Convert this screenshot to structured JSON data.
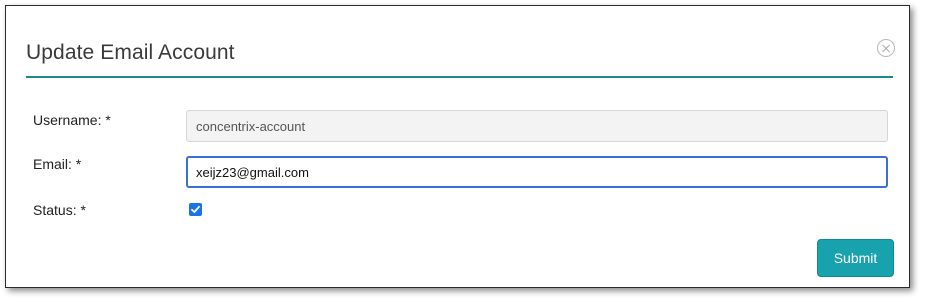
{
  "modal": {
    "title": "Update Email Account",
    "close_icon": "close-circle-icon"
  },
  "form": {
    "username": {
      "label": "Username: *",
      "value": "concentrix-account",
      "disabled": true
    },
    "email": {
      "label": "Email: *",
      "value": "xeijz23@gmail.com",
      "focused": true
    },
    "status": {
      "label": "Status: *",
      "checked": true,
      "check_icon": "checkmark-icon"
    },
    "submit_label": "Submit"
  },
  "colors": {
    "accent": "#17a2ad",
    "header_rule": "#1a8a8f",
    "focus_border": "#3b6fd4",
    "checkbox": "#1a73e8"
  }
}
